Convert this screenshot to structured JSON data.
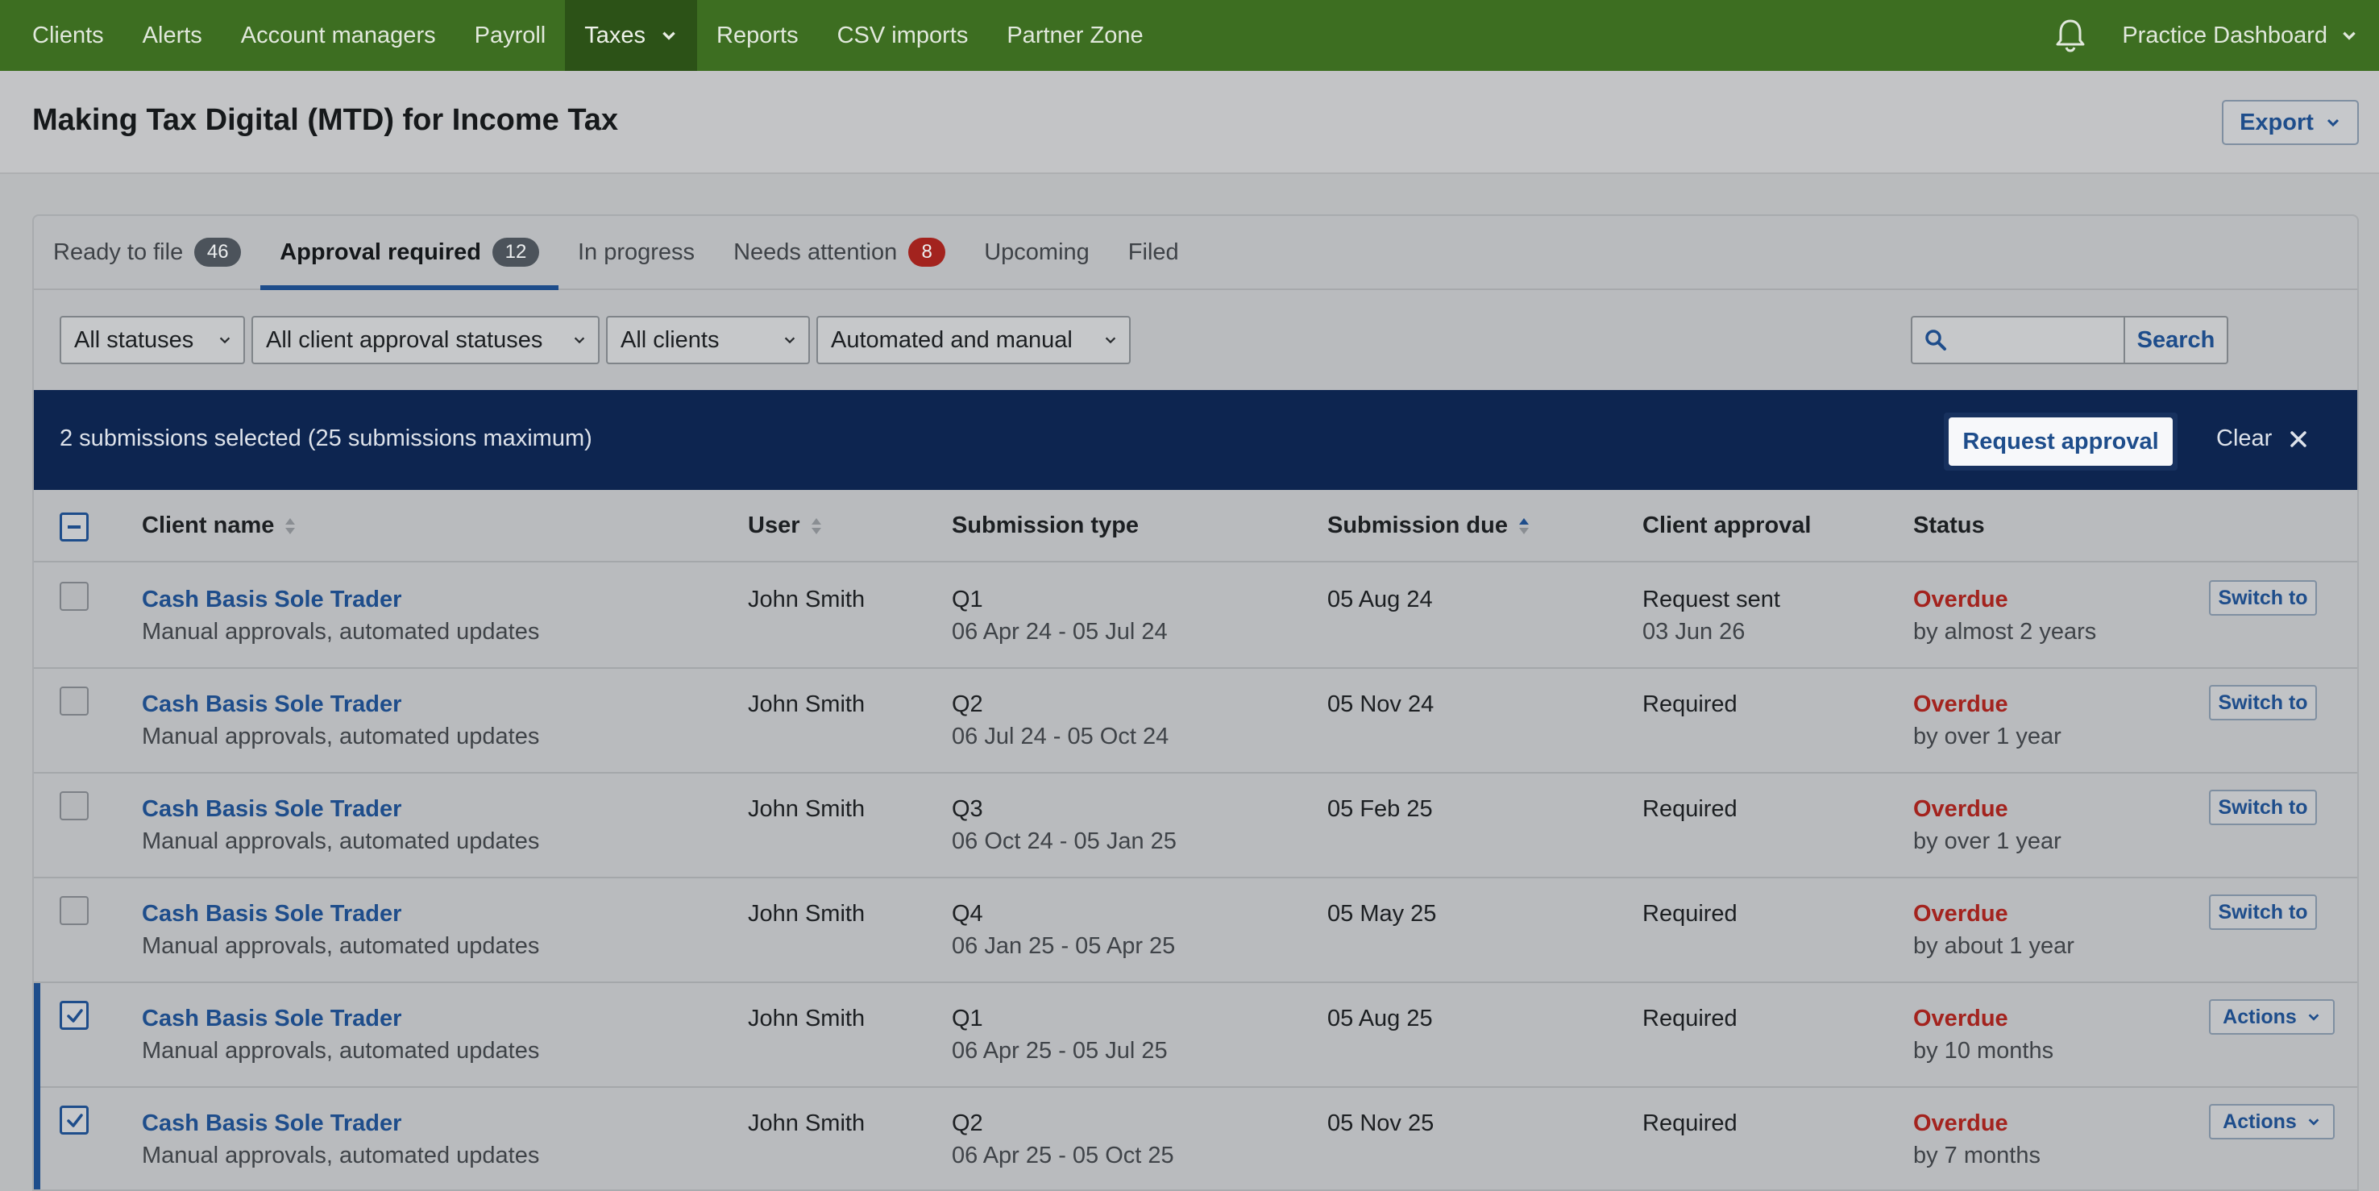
{
  "nav": {
    "items": [
      {
        "label": "Clients"
      },
      {
        "label": "Alerts"
      },
      {
        "label": "Account managers"
      },
      {
        "label": "Payroll"
      },
      {
        "label": "Taxes",
        "active": true
      },
      {
        "label": "Reports"
      },
      {
        "label": "CSV imports"
      },
      {
        "label": "Partner Zone"
      }
    ],
    "practice": "Practice Dashboard"
  },
  "header": {
    "title": "Making Tax Digital (MTD) for Income Tax",
    "export_label": "Export"
  },
  "tabs": [
    {
      "label": "Ready to file",
      "count": "46"
    },
    {
      "label": "Approval required",
      "count": "12",
      "active": true
    },
    {
      "label": "In progress",
      "count": null
    },
    {
      "label": "Needs attention",
      "count": "8",
      "alert": true
    },
    {
      "label": "Upcoming",
      "count": null
    },
    {
      "label": "Filed",
      "count": null
    }
  ],
  "filters": {
    "status": "All statuses",
    "client_approval": "All client approval statuses",
    "clients": "All clients",
    "mode": "Automated and manual",
    "search_value": "",
    "search_label": "Search"
  },
  "banner": {
    "text": "2 submissions selected (25 submissions maximum)",
    "request_label": "Request approval",
    "clear_label": "Clear"
  },
  "columns": {
    "client": "Client name",
    "user": "User",
    "type": "Submission type",
    "due": "Submission due",
    "approval": "Client approval",
    "status": "Status"
  },
  "rows": [
    {
      "client": "Cash Basis Sole Trader",
      "client_sub": "Manual approvals, automated updates",
      "user": "John Smith",
      "type": "Q1",
      "period": "06 Apr 24 - 05 Jul 24",
      "due": "05 Aug 24",
      "approval": "Request sent",
      "approval_sub": "03 Jun 26",
      "status": "Overdue",
      "status_sub": "by almost 2 years",
      "action": "Switch to",
      "checked": false
    },
    {
      "client": "Cash Basis Sole Trader",
      "client_sub": "Manual approvals, automated updates",
      "user": "John Smith",
      "type": "Q2",
      "period": "06 Jul 24 - 05 Oct 24",
      "due": "05 Nov 24",
      "approval": "Required",
      "approval_sub": "",
      "status": "Overdue",
      "status_sub": "by over 1 year",
      "action": "Switch to",
      "checked": false
    },
    {
      "client": "Cash Basis Sole Trader",
      "client_sub": "Manual approvals, automated updates",
      "user": "John Smith",
      "type": "Q3",
      "period": "06 Oct 24 - 05 Jan 25",
      "due": "05 Feb 25",
      "approval": "Required",
      "approval_sub": "",
      "status": "Overdue",
      "status_sub": "by over 1 year",
      "action": "Switch to",
      "checked": false
    },
    {
      "client": "Cash Basis Sole Trader",
      "client_sub": "Manual approvals, automated updates",
      "user": "John Smith",
      "type": "Q4",
      "period": "06 Jan 25 - 05 Apr 25",
      "due": "05 May 25",
      "approval": "Required",
      "approval_sub": "",
      "status": "Overdue",
      "status_sub": "by about 1 year",
      "action": "Switch to",
      "checked": false
    },
    {
      "client": "Cash Basis Sole Trader",
      "client_sub": "Manual approvals, automated updates",
      "user": "John Smith",
      "type": "Q1",
      "period": "06 Apr 25 - 05 Jul 25",
      "due": "05 Aug 25",
      "approval": "Required",
      "approval_sub": "",
      "status": "Overdue",
      "status_sub": "by 10 months",
      "action": "Actions",
      "checked": true
    },
    {
      "client": "Cash Basis Sole Trader",
      "client_sub": "Manual approvals, automated updates",
      "user": "John Smith",
      "type": "Q2",
      "period": "06 Apr 25 - 05 Oct 25",
      "due": "05 Nov 25",
      "approval": "Required",
      "approval_sub": "",
      "status": "Overdue",
      "status_sub": "by 7 months",
      "action": "Actions",
      "checked": true
    }
  ],
  "colors": {
    "nav_bg": "#3d6e21",
    "banner_bg": "#0d2550",
    "link": "#1e4d8b",
    "overdue": "#a3231e"
  }
}
